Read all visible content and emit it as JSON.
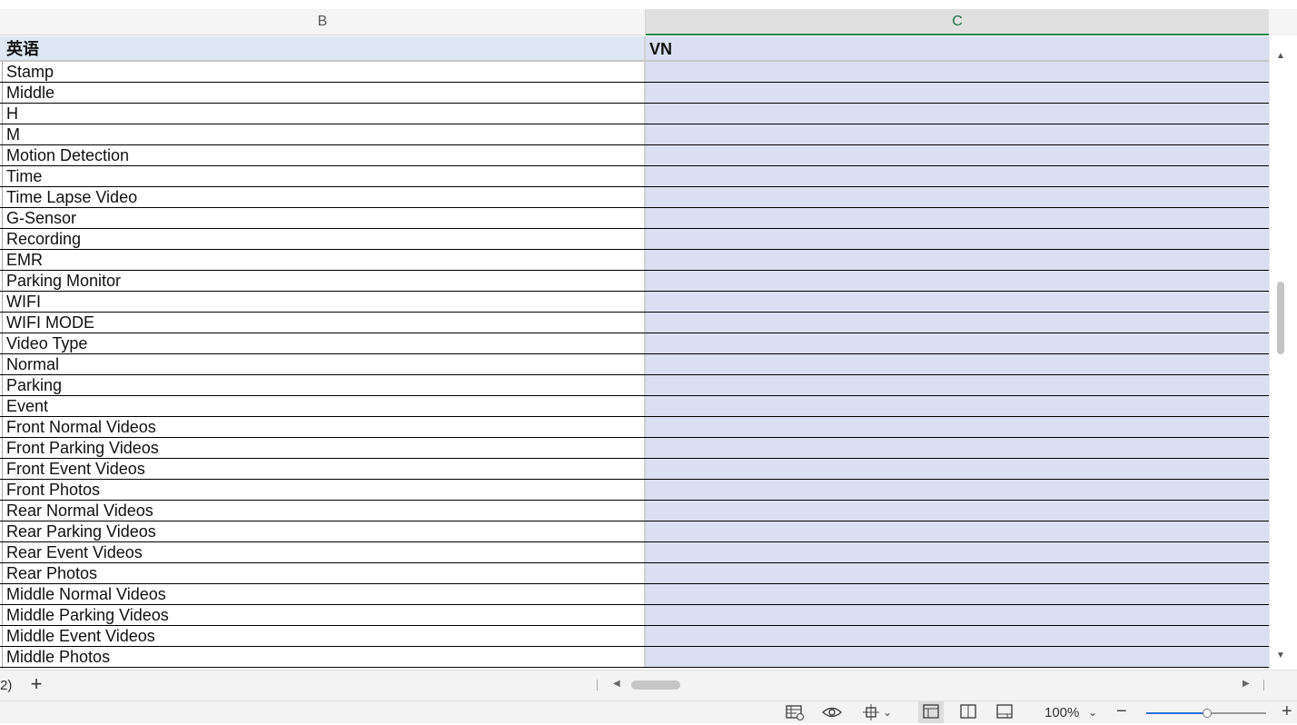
{
  "columns": {
    "b": "B",
    "c": "C"
  },
  "header_row": {
    "b": "英语",
    "c": "VN"
  },
  "rows": [
    "Stamp",
    "Middle",
    "H",
    "M",
    "Motion Detection",
    "Time",
    "Time Lapse Video",
    "G-Sensor",
    "Recording",
    "EMR",
    "Parking Monitor",
    "WIFI",
    "WIFI MODE",
    "Video Type",
    "Normal",
    "Parking",
    "Event",
    "Front Normal Videos",
    "Front Parking Videos",
    "Front Event Videos",
    "Front Photos",
    "Rear Normal Videos",
    "Rear Parking Videos",
    "Rear Event Videos",
    "Rear Photos",
    "Middle Normal Videos",
    "Middle Parking Videos",
    "Middle Event Videos",
    "Middle Photos"
  ],
  "sheet_tabs": {
    "fragment": "2)",
    "add_label": "+"
  },
  "status": {
    "zoom_label": "100%",
    "zoom_level": 0.5
  },
  "icons": {
    "scroll_up": "▲",
    "scroll_down": "▼",
    "scroll_left": "◀",
    "scroll_right": "▶",
    "table_settings": "table-settings-icon",
    "eye": "eye-icon",
    "move": "move-icon",
    "normal_view": "normal-view-icon",
    "page_break": "page-break-view-icon",
    "page_layout": "page-layout-view-icon",
    "zoom_out": "−",
    "zoom_in": "+",
    "dropdown": "⌄"
  },
  "colors": {
    "selected_column": "#dae0f1",
    "header_fill": "#dde8f4",
    "accent": "#1e8a4a"
  }
}
